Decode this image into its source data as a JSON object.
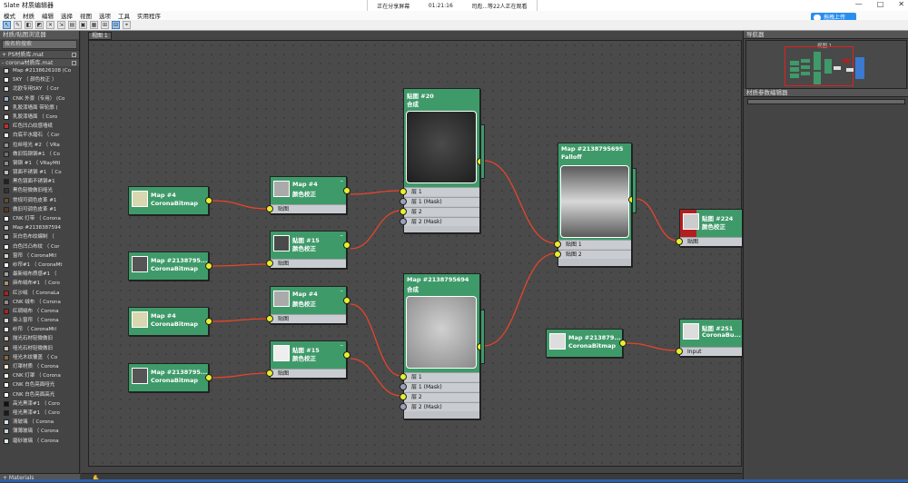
{
  "window": {
    "title": "Slate 材质编辑器",
    "share_status": "正在分享屏幕",
    "share_time": "01:21:16",
    "share_viewers": "司彪...等22人正在观看",
    "upload_button": "拖拽上传",
    "btn_min": "—",
    "btn_max": "□",
    "btn_close": "✕"
  },
  "menu": [
    "模式",
    "材质",
    "编辑",
    "选择",
    "视图",
    "选项",
    "工具",
    "实用程序"
  ],
  "left_panel": {
    "title": "材质/贴图浏览器",
    "search_placeholder": "按名称搜索",
    "group1": "+ PS材质库.mat",
    "group2": "- corona材质库.mat",
    "bottom": "+ Materials",
    "items": [
      {
        "label": "Map #2138626108  (Co",
        "color": "#d8d8d8"
      },
      {
        "label": "SKY  （ 颜色校正 ）",
        "color": "#ffffff"
      },
      {
        "label": "北欧专用SKY  （ Cor",
        "color": "#e0e0e0"
      },
      {
        "label": "CNK 外景（专用） (Co",
        "color": "#9ab0c8"
      },
      {
        "label": "乳胶漆墙面  带轮廓 (",
        "color": "#efefef"
      },
      {
        "label": "乳胶漆墙面  （ Coro",
        "color": "#efefef"
      },
      {
        "label": "红色凹凸纹感墙纸",
        "color": "#c03030"
      },
      {
        "label": "白底平水磨石  （ Cor",
        "color": "#e8e8e8"
      },
      {
        "label": "拉丝哑光 #2  （ VRa",
        "color": "#909090"
      },
      {
        "label": "做旧钨钢钢#1  （ Co",
        "color": "#707070"
      },
      {
        "label": "钢钢 #1  （ VRayMtl",
        "color": "#8a8a8a"
      },
      {
        "label": "镜面不锈钢 #1  （ Co",
        "color": "#bbbbbb"
      },
      {
        "label": "黑色镜面不锈钢#1",
        "color": "#222222"
      },
      {
        "label": "黑色轻微做旧哑光",
        "color": "#333333"
      },
      {
        "label": "常规可调色皮革 #1",
        "color": "#6b4a30"
      },
      {
        "label": "做旧可调色皮革 #1",
        "color": "#5a3a20"
      },
      {
        "label": "CNK 灯带  （ Corona",
        "color": "#ffffff"
      },
      {
        "label": "Map #2138387594",
        "color": "#c8c8c8"
      },
      {
        "label": "灰白色布纹编制  （",
        "color": "#c0c0c0"
      },
      {
        "label": "白色凹凸布纹  （ Cor",
        "color": "#f0f0f0"
      },
      {
        "label": "窗帘  （ CoronaMtl",
        "color": "#d8d0c0"
      },
      {
        "label": "纱帘#1  （ CoronaMt",
        "color": "#f4f4f4"
      },
      {
        "label": "最新绒布质感#1 （",
        "color": "#a0a0a0"
      },
      {
        "label": "麻布绒布#1  （ Coro",
        "color": "#a89070"
      },
      {
        "label": "红沙绒  （ CoronaLa",
        "color": "#b02020"
      },
      {
        "label": "CNK 绒布  （ Corona",
        "color": "#8a8a8a"
      },
      {
        "label": "红绸绒布  （ Corona",
        "color": "#a02828"
      },
      {
        "label": "染上窗帘  （ Corona",
        "color": "#d8d8d8"
      },
      {
        "label": "纱帘  （ CoronaMtl",
        "color": "#eeeeee"
      },
      {
        "label": "抛光石材轻微做旧",
        "color": "#d0c8b8"
      },
      {
        "label": "哑光石材轻微做旧",
        "color": "#c8c0b0"
      },
      {
        "label": "哑光木纹覆盖  （ Co",
        "color": "#8a6a40"
      },
      {
        "label": "灯罩材质  （ Corona",
        "color": "#f0e8d0"
      },
      {
        "label": "CNK 灯罩  （ Corona",
        "color": "#f8f0e0"
      },
      {
        "label": "CNK 白色亮面哑光",
        "color": "#ffffff"
      },
      {
        "label": "CNK 白色亮面高光",
        "color": "#ffffff"
      },
      {
        "label": "高光黑漆#1  （ Coro",
        "color": "#111111"
      },
      {
        "label": "哑光黑漆#1  （ Coro",
        "color": "#1a1a1a"
      },
      {
        "label": "清玻璃  （ Corona",
        "color": "#cfe0e8"
      },
      {
        "label": "薄薄玻璃  （ Corona",
        "color": "#c0d4dc"
      },
      {
        "label": "磨砂玻璃  （ Corona",
        "color": "#dde8ec"
      }
    ]
  },
  "view": {
    "tab": "视图 1",
    "nodes": {
      "n1": {
        "title": "Map #4",
        "sub": "CoronaBitmap"
      },
      "n2": {
        "title": "Map #2138795...",
        "sub": "CoronaBitmap"
      },
      "n3": {
        "title": "Map #4",
        "sub": "CoronaBitmap"
      },
      "n4": {
        "title": "Map #2138795...",
        "sub": "CoronaBitmap"
      },
      "cc1": {
        "title": "Map #4",
        "sub": "颜色校正",
        "slot": "贴图"
      },
      "cc2": {
        "title": "贴图 #15",
        "sub": "颜色校正",
        "slot": "贴图"
      },
      "cc3": {
        "title": "Map #4",
        "sub": "颜色校正",
        "slot": "贴图"
      },
      "cc4": {
        "title": "贴图 #15",
        "sub": "颜色校正",
        "slot": "贴图"
      },
      "comp1": {
        "title": "贴图 #20",
        "sub": "合成",
        "slots": [
          "层 1",
          "层 1 (Mask)",
          "层 2",
          "层 2 (Mask)"
        ]
      },
      "comp2": {
        "title": "Map #2138795694",
        "sub": "合成",
        "slots": [
          "层 1",
          "层 1 (Mask)",
          "层 2",
          "层 2 (Mask)"
        ]
      },
      "falloff": {
        "title": "Map #2138795695",
        "sub": "Falloff",
        "slots": [
          "贴图 1",
          "贴图 2"
        ]
      },
      "bitmap5": {
        "title": "Map #213879...",
        "sub": "CoronaBitmap"
      },
      "cc224": {
        "title": "贴图 #224",
        "sub": "颜色校正",
        "slot": "贴图"
      },
      "cb251": {
        "title": "贴图 #251",
        "sub": "CoronaBu...",
        "slot": "Input"
      }
    }
  },
  "right_panel": {
    "nav_title": "导航器",
    "nav_label": "视图 1",
    "prop_title": "材质参数编辑器"
  },
  "colors": {
    "node_header": "#3f9a6a",
    "wire": "#e8442a",
    "port_active": "#e7ef2b"
  }
}
